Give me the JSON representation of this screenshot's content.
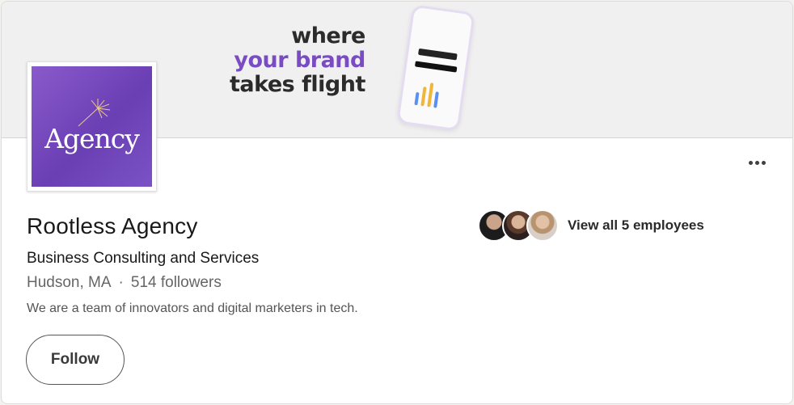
{
  "banner": {
    "line1": "where",
    "line2": "your brand",
    "line3": "takes flight"
  },
  "logo": {
    "word": "Agency"
  },
  "company": {
    "name": "Rootless Agency",
    "industry": "Business Consulting and Services",
    "location": "Hudson, MA",
    "separator": "·",
    "followers": "514 followers",
    "tagline": "We are a team of innovators and digital marketers in tech."
  },
  "actions": {
    "follow_label": "Follow"
  },
  "employees": {
    "link_label": "View all 5 employees"
  },
  "colors": {
    "brand_purple": "#7a4cc4",
    "text_dark": "#191919",
    "text_muted": "#666666"
  }
}
